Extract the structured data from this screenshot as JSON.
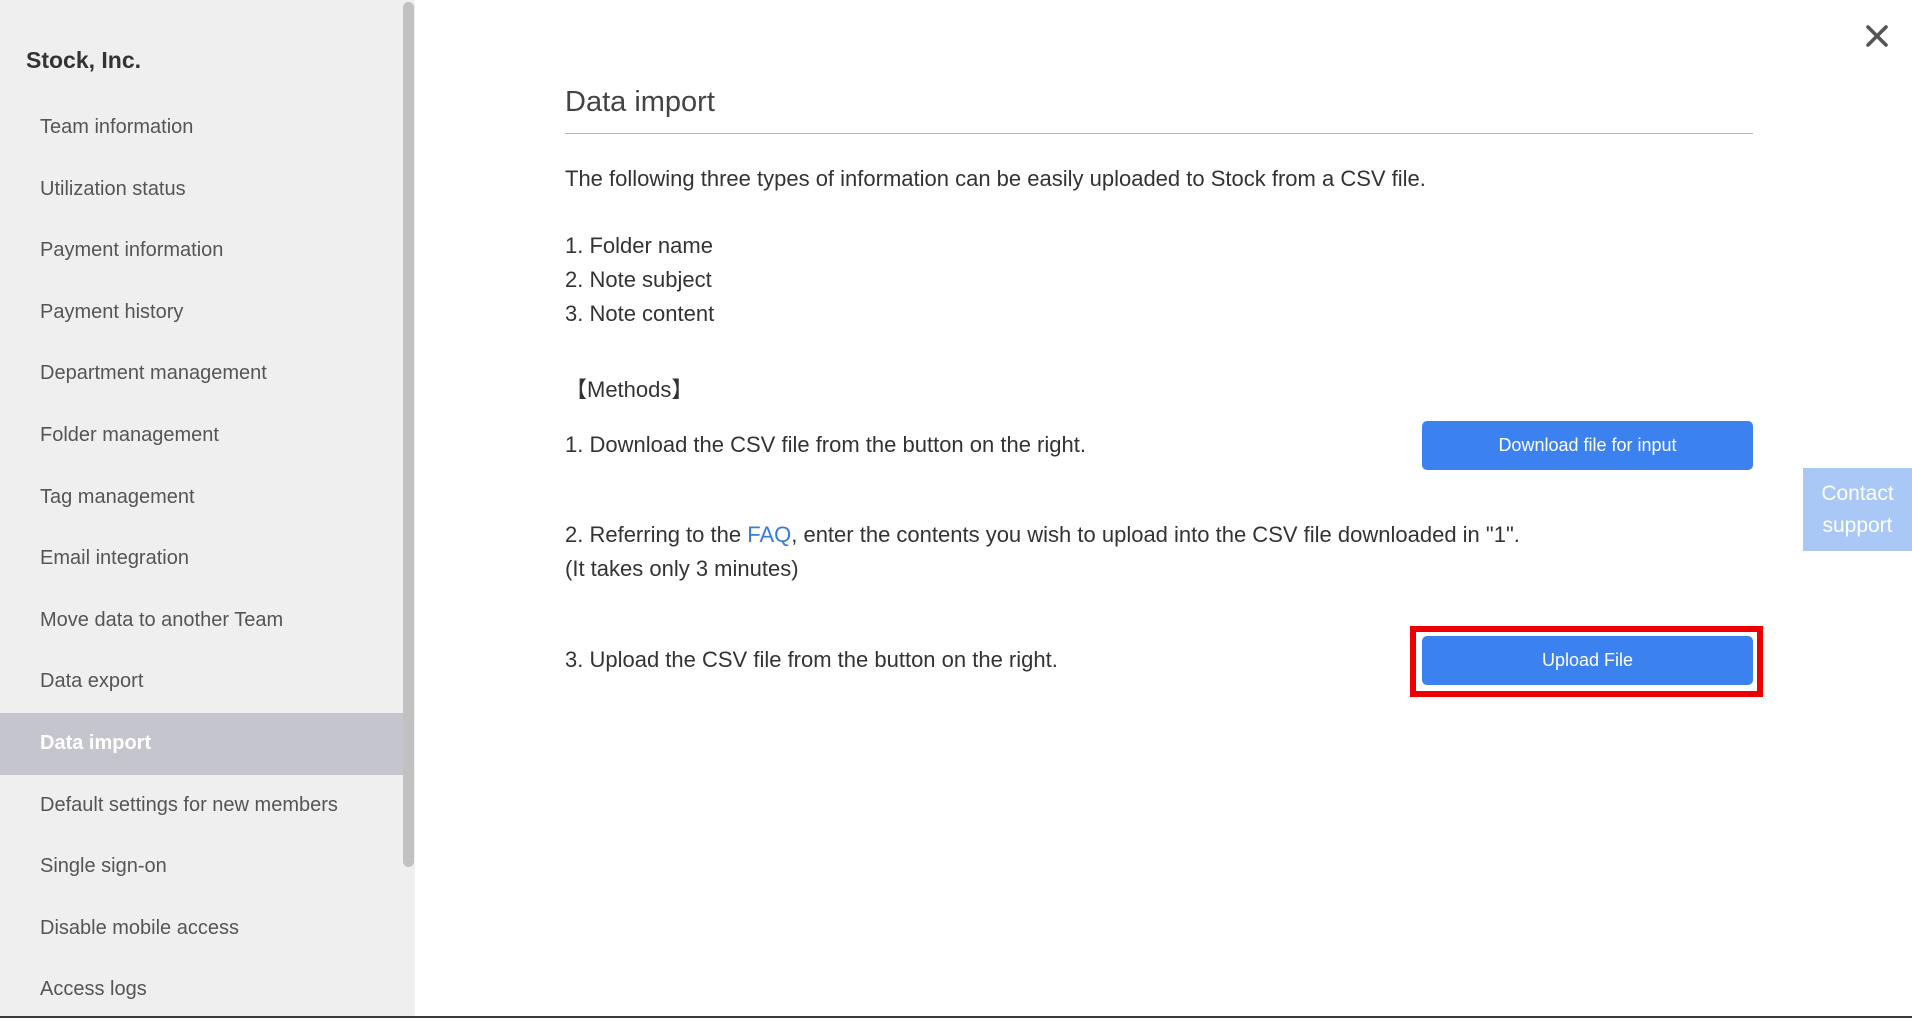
{
  "sidebar": {
    "org_name": "Stock, Inc.",
    "items": [
      {
        "label": "Team information",
        "active": false
      },
      {
        "label": "Utilization status",
        "active": false
      },
      {
        "label": "Payment information",
        "active": false
      },
      {
        "label": "Payment history",
        "active": false
      },
      {
        "label": "Department management",
        "active": false
      },
      {
        "label": "Folder management",
        "active": false
      },
      {
        "label": "Tag management",
        "active": false
      },
      {
        "label": "Email integration",
        "active": false
      },
      {
        "label": "Move data to another Team",
        "active": false
      },
      {
        "label": "Data export",
        "active": false
      },
      {
        "label": "Data import",
        "active": true
      },
      {
        "label": "Default settings for new members",
        "active": false
      },
      {
        "label": "Single sign-on",
        "active": false
      },
      {
        "label": "Disable mobile access",
        "active": false
      },
      {
        "label": "Access logs",
        "active": false
      }
    ]
  },
  "close_icon": "close-icon",
  "main": {
    "title": "Data import",
    "intro": "The following three types of information can be easily uploaded to Stock from a CSV file.",
    "info_types": [
      "1. Folder name",
      "2. Note subject",
      "3. Note content"
    ],
    "methods_heading": "【Methods】",
    "step1": {
      "text": "1. Download the CSV file from the button on the right.",
      "button_label": "Download file for input"
    },
    "step2": {
      "prefix": "2. Referring to the ",
      "link_text": "FAQ",
      "suffix": ", enter the contents you wish to upload into the CSV file downloaded in \"1\".",
      "note": "(It takes only 3 minutes)"
    },
    "step3": {
      "text": "3. Upload the CSV file from the button on the right.",
      "button_label": "Upload File"
    }
  },
  "contact": {
    "line1": "Contact",
    "line2": "support"
  },
  "colors": {
    "primary_button": "#3b82f0",
    "link": "#3a7bd5",
    "highlight": "#ee0000",
    "active_nav_bg": "#c5c5cd",
    "contact_bg": "#a9c8f5"
  }
}
